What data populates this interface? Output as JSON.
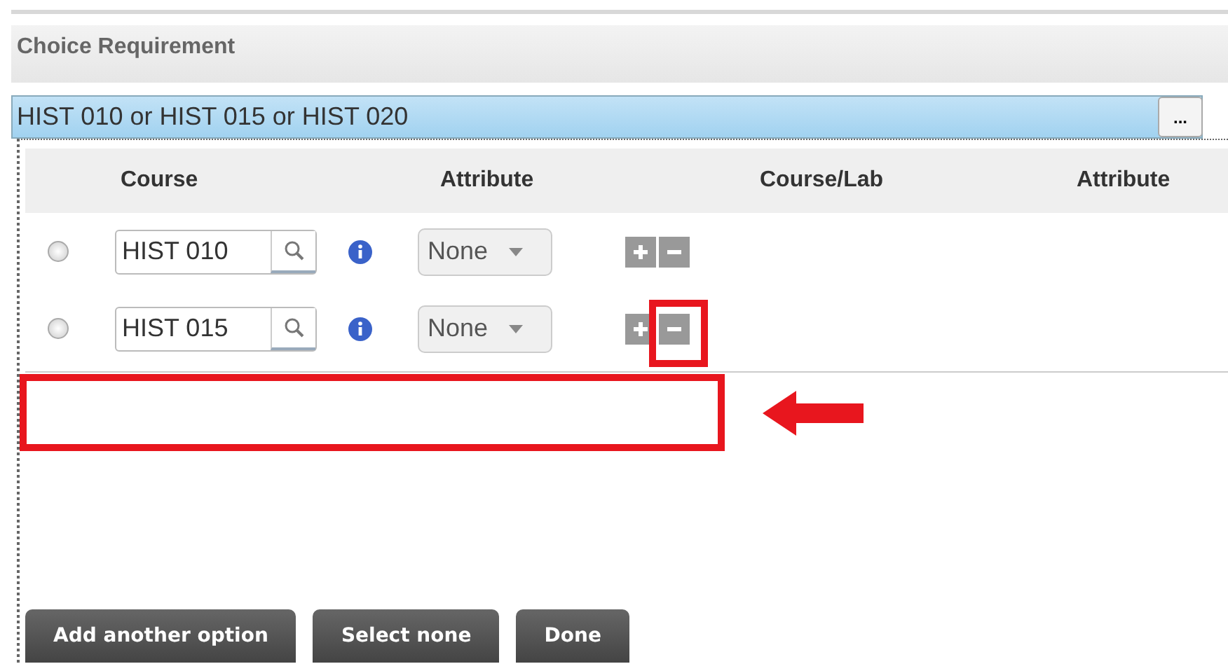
{
  "section": {
    "title": "Choice Requirement"
  },
  "requirement": {
    "value": "HIST 010 or HIST 015 or HIST 020",
    "more_button": "..."
  },
  "table": {
    "columns": [
      "Course",
      "Attribute",
      "Course/Lab",
      "Attribute"
    ],
    "rows": [
      {
        "selected": false,
        "course": "HIST 010",
        "attribute": "None"
      },
      {
        "selected": false,
        "course": "HIST 015",
        "attribute": "None"
      }
    ]
  },
  "buttons": [
    "Add another option",
    "Select none",
    "Done"
  ]
}
